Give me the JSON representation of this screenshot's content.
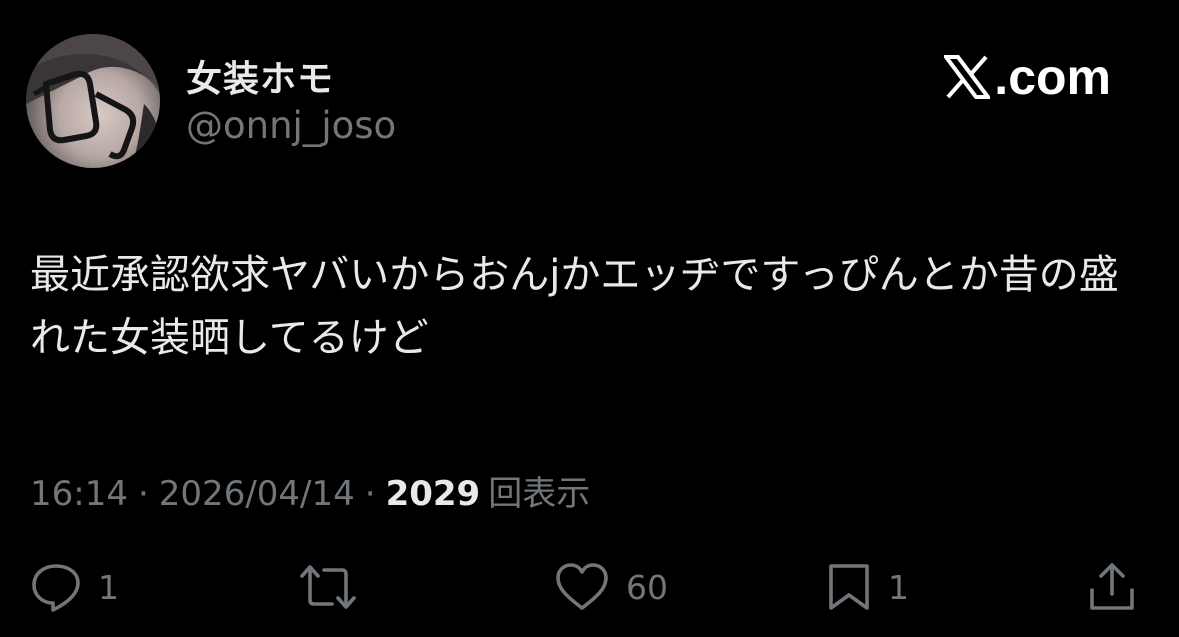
{
  "user": {
    "display_name": "女装ホモ",
    "handle": "@onnj_joso",
    "avatar_icon": "profile-photo"
  },
  "brand": {
    "label": ".com",
    "icon": "x-logo-icon"
  },
  "tweet": {
    "text": "最近承認欲求ヤバいからおんjかエッヂですっぴんとか昔の盛れた女装晒してるけど"
  },
  "meta": {
    "time": "16:14",
    "separator": "·",
    "date": "2026/04/14",
    "views": "2029",
    "views_label": "回表示"
  },
  "actions": {
    "reply_count": "1",
    "retweet_count": "",
    "like_count": "60",
    "bookmark_count": "1"
  },
  "colors": {
    "background": "#000000",
    "primary_text": "#e7e9ea",
    "secondary_text": "#71767b"
  }
}
